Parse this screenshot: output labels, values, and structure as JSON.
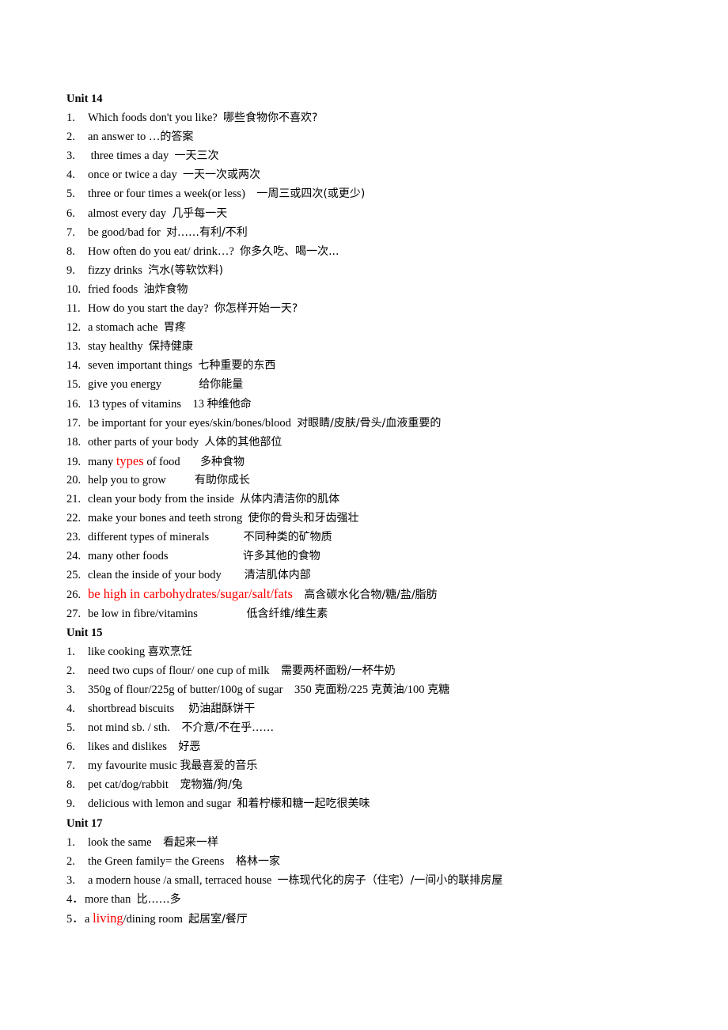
{
  "sections": [
    {
      "title": "Unit 14",
      "items": [
        {
          "num": "1.",
          "segments": [
            {
              "t": "Which foods don't you like?  "
            },
            {
              "t": "哪些食物你不喜欢?",
              "cn": true
            }
          ]
        },
        {
          "num": "2.",
          "segments": [
            {
              "t": "an answer to …"
            },
            {
              "t": "的答案",
              "cn": true
            }
          ]
        },
        {
          "num": "3.",
          "segments": [
            {
              "t": " three times a day  "
            },
            {
              "t": "一天三次",
              "cn": true
            }
          ]
        },
        {
          "num": "4.",
          "segments": [
            {
              "t": "once or twice a day  "
            },
            {
              "t": "一天一次或两次",
              "cn": true
            }
          ]
        },
        {
          "num": "5.",
          "segments": [
            {
              "t": "three or four times a week(or less)    "
            },
            {
              "t": "一周三或四次(或更少)",
              "cn": true
            }
          ]
        },
        {
          "num": "6.",
          "segments": [
            {
              "t": "almost every day  "
            },
            {
              "t": "几乎每一天",
              "cn": true
            }
          ]
        },
        {
          "num": "7.",
          "segments": [
            {
              "t": "be good/bad for  "
            },
            {
              "t": "对……有利/不利",
              "cn": true
            }
          ]
        },
        {
          "num": "8.",
          "segments": [
            {
              "t": "How often do you eat/ drink…?  "
            },
            {
              "t": "你多久吃、喝一次...",
              "cn": true
            }
          ]
        },
        {
          "num": "9.",
          "segments": [
            {
              "t": "fizzy drinks  "
            },
            {
              "t": "汽水(等软饮料)",
              "cn": true
            }
          ]
        },
        {
          "num": "10.",
          "segments": [
            {
              "t": "fried foods  "
            },
            {
              "t": "油炸食物",
              "cn": true
            }
          ]
        },
        {
          "num": "11.",
          "segments": [
            {
              "t": "How do you start the day?  "
            },
            {
              "t": "你怎样开始一天?",
              "cn": true
            }
          ]
        },
        {
          "num": "12.",
          "segments": [
            {
              "t": "a stomach ache  "
            },
            {
              "t": "胃疼",
              "cn": true
            }
          ]
        },
        {
          "num": "13.",
          "segments": [
            {
              "t": "stay healthy  "
            },
            {
              "t": "保持健康",
              "cn": true
            }
          ]
        },
        {
          "num": "14.",
          "segments": [
            {
              "t": "seven important things  "
            },
            {
              "t": "七种重要的东西",
              "cn": true
            }
          ]
        },
        {
          "num": "15.",
          "segments": [
            {
              "t": "give you energy             "
            },
            {
              "t": "给你能量",
              "cn": true
            }
          ]
        },
        {
          "num": "16.",
          "segments": [
            {
              "t": "13 types of vitamins    13 "
            },
            {
              "t": "种维他命",
              "cn": true
            }
          ]
        },
        {
          "num": "17.",
          "segments": [
            {
              "t": "be important for your eyes/skin/bones/blood  "
            },
            {
              "t": "对眼睛/皮肤/骨头/血液重要的",
              "cn": true
            }
          ]
        },
        {
          "num": "18.",
          "segments": [
            {
              "t": "other parts of your body  "
            },
            {
              "t": "人体的其他部位",
              "cn": true
            }
          ]
        },
        {
          "num": "19.",
          "segments": [
            {
              "t": "many "
            },
            {
              "t": "types",
              "red": true
            },
            {
              "t": " of food       "
            },
            {
              "t": "多种食物",
              "cn": true
            }
          ]
        },
        {
          "num": "20.",
          "segments": [
            {
              "t": "help you to grow          "
            },
            {
              "t": "有助你成长",
              "cn": true
            }
          ]
        },
        {
          "num": "21.",
          "segments": [
            {
              "t": "clean your body from the inside  "
            },
            {
              "t": "从体内清洁你的肌体",
              "cn": true
            }
          ]
        },
        {
          "num": "22.",
          "segments": [
            {
              "t": "make your bones and teeth strong  "
            },
            {
              "t": "使你的骨头和牙齿强壮",
              "cn": true
            }
          ]
        },
        {
          "num": "23.",
          "segments": [
            {
              "t": "different types of minerals            "
            },
            {
              "t": "不同种类的矿物质",
              "cn": true
            }
          ]
        },
        {
          "num": "24.",
          "segments": [
            {
              "t": "many other foods                          "
            },
            {
              "t": "许多其他的食物",
              "cn": true
            }
          ]
        },
        {
          "num": "25.",
          "segments": [
            {
              "t": "clean the inside of your body        "
            },
            {
              "t": "清洁肌体内部",
              "cn": true
            }
          ]
        },
        {
          "num": "26.",
          "segments": [
            {
              "t": "be high in carbohydrates/sugar/salt/fats",
              "red": true
            },
            {
              "t": "    "
            },
            {
              "t": "高含碳水化合物/糖/盐/脂肪",
              "cn": true
            }
          ]
        },
        {
          "num": "27.",
          "segments": [
            {
              "t": "be low in fibre/vitamins                 "
            },
            {
              "t": "低含纤维/维生素",
              "cn": true
            }
          ]
        }
      ]
    },
    {
      "title": "Unit 15",
      "items": [
        {
          "num": "1.",
          "segments": [
            {
              "t": "like cooking "
            },
            {
              "t": "喜欢烹饪",
              "cn": true
            }
          ]
        },
        {
          "num": "2.",
          "segments": [
            {
              "t": "need two cups of flour/ one cup of milk    "
            },
            {
              "t": "需要两杯面粉/一杯牛奶",
              "cn": true
            }
          ]
        },
        {
          "num": "3.",
          "segments": [
            {
              "t": "350g of flour/225g of butter/100g of sugar    350 "
            },
            {
              "t": "克面粉",
              "cn": true
            },
            {
              "t": "/225 "
            },
            {
              "t": "克黄油",
              "cn": true
            },
            {
              "t": "/100 "
            },
            {
              "t": "克糖",
              "cn": true
            }
          ]
        },
        {
          "num": "4.",
          "segments": [
            {
              "t": "shortbread biscuits     "
            },
            {
              "t": "奶油甜酥饼干",
              "cn": true
            }
          ]
        },
        {
          "num": "5.",
          "segments": [
            {
              "t": "not mind sb. / sth.    "
            },
            {
              "t": "不介意/不在乎……",
              "cn": true
            }
          ]
        },
        {
          "num": "6.",
          "segments": [
            {
              "t": "likes and dislikes    "
            },
            {
              "t": "好恶",
              "cn": true
            }
          ]
        },
        {
          "num": "7.",
          "segments": [
            {
              "t": "my favourite music "
            },
            {
              "t": "我最喜爱的音乐",
              "cn": true
            }
          ]
        },
        {
          "num": "8.",
          "segments": [
            {
              "t": "pet cat/dog/rabbit    "
            },
            {
              "t": "宠物猫/狗/兔",
              "cn": true
            }
          ]
        },
        {
          "num": "9.",
          "segments": [
            {
              "t": "delicious with lemon and sugar  "
            },
            {
              "t": "和着柠檬和糖一起吃很美味",
              "cn": true
            }
          ]
        }
      ]
    },
    {
      "title": "Unit 17",
      "items": [
        {
          "num": "1.",
          "segments": [
            {
              "t": "look the same    "
            },
            {
              "t": "看起来一样",
              "cn": true
            }
          ]
        },
        {
          "num": "2.",
          "segments": [
            {
              "t": "the Green family= the Greens    "
            },
            {
              "t": "格林一家",
              "cn": true
            }
          ]
        },
        {
          "num": "3.",
          "segments": [
            {
              "t": "a modern house /a small, terraced house  "
            },
            {
              "t": "一栋现代化的房子（住宅）/一间小的联排房屋",
              "cn": true
            }
          ]
        },
        {
          "num": "4．",
          "narrow": true,
          "segments": [
            {
              "t": "more than  "
            },
            {
              "t": "比……多",
              "cn": true
            }
          ]
        },
        {
          "num": "5．",
          "narrow": true,
          "segments": [
            {
              "t": "a "
            },
            {
              "t": "living",
              "red": true
            },
            {
              "t": "/dining room  "
            },
            {
              "t": "起居室/餐厅",
              "cn": true
            }
          ]
        }
      ]
    }
  ]
}
